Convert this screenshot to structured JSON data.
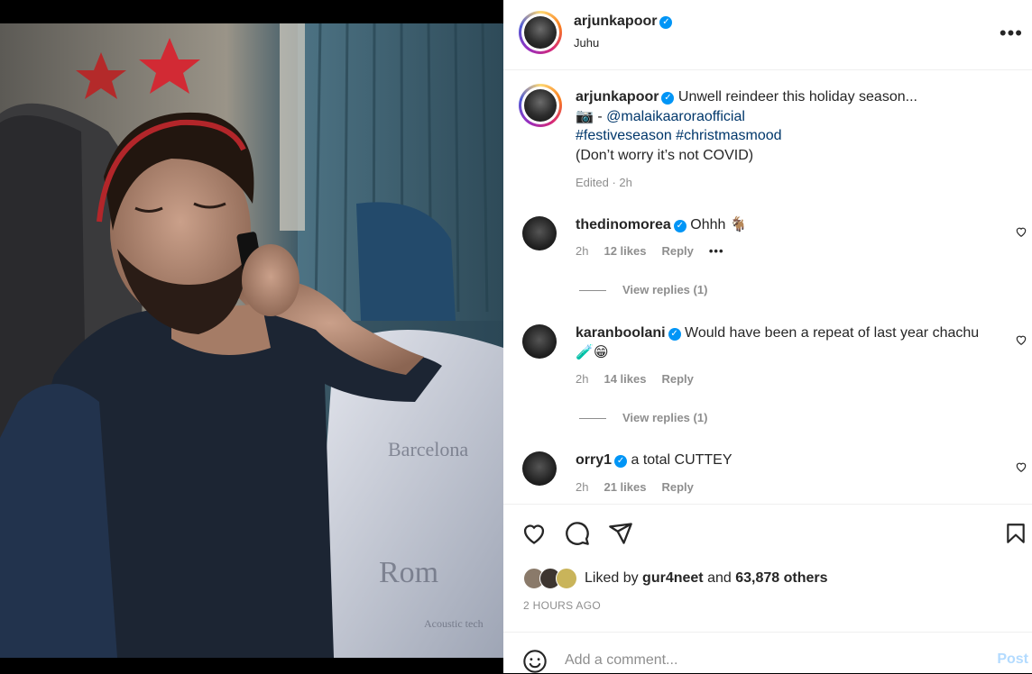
{
  "post": {
    "username": "arjunkapoor",
    "location": "Juhu",
    "more_icon": "•••"
  },
  "caption": {
    "username": "arjunkapoor",
    "line1": "Unwell reindeer this holiday season...",
    "camera_emoji": "📷",
    "credit_prefix": " - ",
    "credit_mention": "@malaikaaroraofficial",
    "hashtags": "#festiveseason #christmasmood",
    "line4": "(Don’t worry it’s not COVID)",
    "meta": "Edited · 2h"
  },
  "comments": [
    {
      "username": "thedinomorea",
      "text": "Ohhh 🐐",
      "time": "2h",
      "likes": "12 likes",
      "reply": "Reply",
      "more": "•••",
      "view_replies": "View replies (1)"
    },
    {
      "username": "karanboolani",
      "text": "Would have been a repeat of last year chachu",
      "text2": "🧪😁",
      "time": "2h",
      "likes": "14 likes",
      "reply": "Reply",
      "view_replies": "View replies (1)"
    },
    {
      "username": "orry1",
      "text": "a total CUTTEY",
      "time": "2h",
      "likes": "21 likes",
      "reply": "Reply"
    }
  ],
  "likes": {
    "prefix": "Liked by ",
    "user": "gur4neet",
    "middle": " and ",
    "count": "63,878 others"
  },
  "timestamp": "2 HOURS AGO",
  "add_comment": {
    "placeholder": "Add a comment...",
    "post_label": "Post"
  },
  "colors": {
    "verified": "#0095f6",
    "link": "#00376b",
    "muted": "#8e8e8e",
    "post_disabled": "#b3dbff"
  },
  "icons": [
    "heart-icon",
    "comment-icon",
    "share-icon",
    "bookmark-icon",
    "emoji-icon",
    "verified-icon",
    "more-options-icon"
  ]
}
